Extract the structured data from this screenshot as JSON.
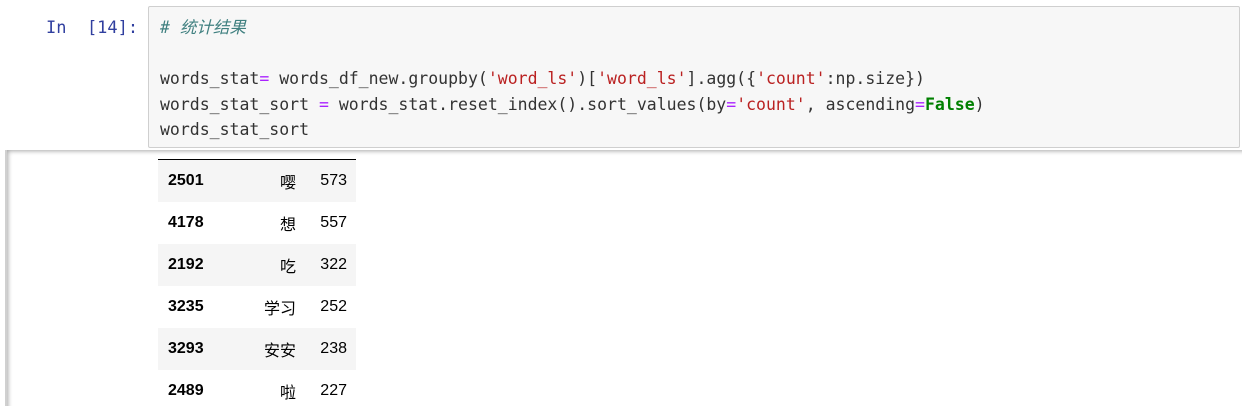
{
  "cell": {
    "prompt": "In  [14]:",
    "code": {
      "comment": "# 统计结果",
      "line1": {
        "a": "words_stat",
        "eq": "=",
        "b": " words_df_new.groupby(",
        "s1": "'word_ls'",
        "c": ")[",
        "s2": "'word_ls'",
        "d": "].agg({",
        "s3": "'count'",
        "e": ":np.size})"
      },
      "line2": {
        "a": "words_stat_sort ",
        "eq": "=",
        "b": " words_stat.reset_index().sort_values(by",
        "eq2": "=",
        "s1": "'count'",
        "c": ", ascending",
        "eq3": "=",
        "kw": "False",
        "d": ")"
      },
      "line3": "words_stat_sort"
    }
  },
  "output": {
    "rows": [
      {
        "index": "2501",
        "word": "嘤",
        "count": "573"
      },
      {
        "index": "4178",
        "word": "想",
        "count": "557"
      },
      {
        "index": "2192",
        "word": "吃",
        "count": "322"
      },
      {
        "index": "3235",
        "word": "学习",
        "count": "252"
      },
      {
        "index": "3293",
        "word": "安安",
        "count": "238"
      },
      {
        "index": "2489",
        "word": "啦",
        "count": "227"
      }
    ]
  }
}
